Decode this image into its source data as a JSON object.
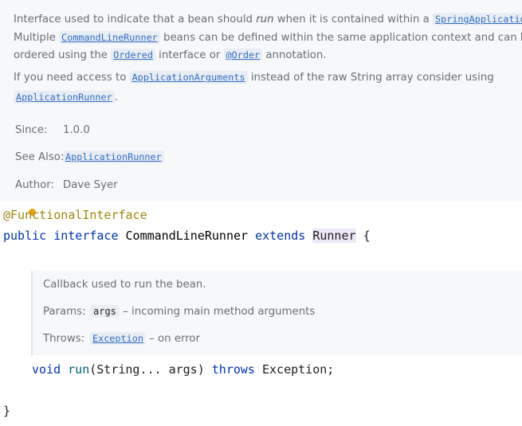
{
  "doc": {
    "line1_a": "Interface used to indicate that a bean should ",
    "line1_run": "run",
    "line1_b": " when it is contained within a ",
    "link_spring_app": "SpringApplication",
    "line1_c": ".",
    "line2_a": "Multiple ",
    "link_clr": "CommandLineRunner",
    "line2_b": " beans can be defined within the same application context and can be",
    "line3_a": "ordered using the ",
    "link_ordered": "Ordered",
    "line3_b": " interface or ",
    "link_order_anno": "@Order",
    "line3_c": " annotation.",
    "line4_a": "If you need access to ",
    "link_app_args": "ApplicationArguments",
    "line4_b": " instead of the raw String array consider using",
    "link_app_runner1": "ApplicationRunner",
    "line5_b": ".",
    "since_label": "Since:",
    "since_value": "1.0.0",
    "see_label": "See Also:",
    "see_link": "ApplicationRunner",
    "author_label": "Author:",
    "author_value": "Dave Syer"
  },
  "code": {
    "annotation": "@FunctionalInterface",
    "kw_public": "public",
    "kw_interface": "interface",
    "class_name": "CommandLineRunner",
    "kw_extends": "extends",
    "super_name": "Runner",
    "open_brace": "{",
    "kw_void": "void",
    "method": "run",
    "params": "(String... args)",
    "kw_throws": "throws",
    "exception": "Exception;",
    "close_brace": "}"
  },
  "inner_doc": {
    "summary": "Callback used to run the bean.",
    "params_label": "Params:",
    "param_name": "args",
    "param_desc": " – incoming main method arguments",
    "throws_label": "Throws:",
    "throws_link": "Exception",
    "throws_desc": " – on error"
  }
}
